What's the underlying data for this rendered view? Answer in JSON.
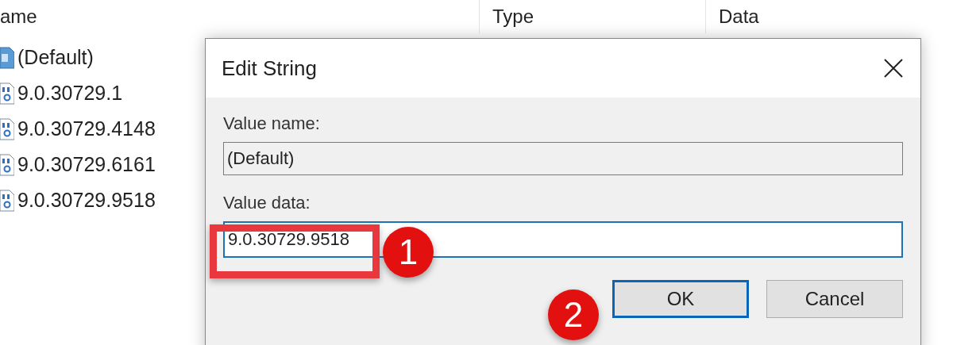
{
  "list": {
    "columns": [
      "ame",
      "Type",
      "Data"
    ],
    "rows": [
      {
        "name": "(Default)",
        "kind": "string"
      },
      {
        "name": "9.0.30729.1",
        "kind": "binary"
      },
      {
        "name": "9.0.30729.4148",
        "kind": "binary"
      },
      {
        "name": "9.0.30729.6161",
        "kind": "binary"
      },
      {
        "name": "9.0.30729.9518",
        "kind": "binary"
      }
    ]
  },
  "dialog": {
    "title": "Edit String",
    "value_name_label": "Value name:",
    "value_name": "(Default)",
    "value_data_label": "Value data:",
    "value_data": "9.0.30729.9518",
    "buttons": [
      {
        "label": "OK",
        "default": true
      },
      {
        "label": "Cancel",
        "default": false
      }
    ]
  },
  "annotations": [
    {
      "label": "1"
    },
    {
      "label": "2"
    }
  ]
}
